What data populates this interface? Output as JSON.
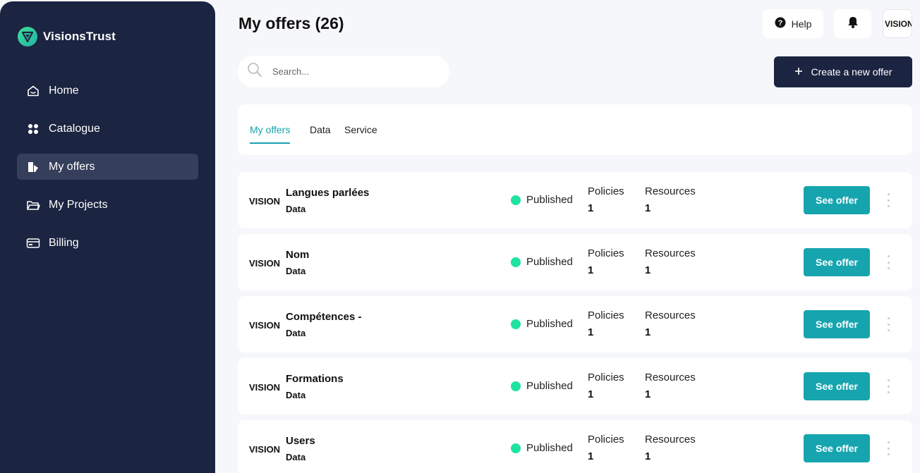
{
  "brand": {
    "name": "VisionsTrust"
  },
  "sidebar": {
    "items": [
      {
        "label": "Home",
        "icon": "home-icon"
      },
      {
        "label": "Catalogue",
        "icon": "grid-icon"
      },
      {
        "label": "My offers",
        "icon": "offers-icon",
        "active": true
      },
      {
        "label": "My Projects",
        "icon": "folder-icon"
      },
      {
        "label": "Billing",
        "icon": "billing-icon"
      }
    ]
  },
  "header": {
    "title": "My offers (26)",
    "help_label": "Help",
    "org_label": "VISIONS"
  },
  "search": {
    "placeholder": "Search..."
  },
  "create_label": "Create a new offer",
  "tabs": [
    {
      "label": "My offers",
      "active": true
    },
    {
      "label": "Data"
    },
    {
      "label": "Service"
    }
  ],
  "offers": [
    {
      "logo": "VISIONS",
      "title": "Langues parlées",
      "type": "Data",
      "status": "Published",
      "policies_label": "Policies",
      "policies": "1",
      "resources_label": "Resources",
      "resources": "1",
      "action": "See offer"
    },
    {
      "logo": "VISIONS",
      "title": "Nom",
      "type": "Data",
      "status": "Published",
      "policies_label": "Policies",
      "policies": "1",
      "resources_label": "Resources",
      "resources": "1",
      "action": "See offer"
    },
    {
      "logo": "VISIONS",
      "title": "Compétences -",
      "type": "Data",
      "status": "Published",
      "policies_label": "Policies",
      "policies": "1",
      "resources_label": "Resources",
      "resources": "1",
      "action": "See offer"
    },
    {
      "logo": "VISIONS",
      "title": "Formations",
      "type": "Data",
      "status": "Published",
      "policies_label": "Policies",
      "policies": "1",
      "resources_label": "Resources",
      "resources": "1",
      "action": "See offer"
    },
    {
      "logo": "VISIONS",
      "title": "Users",
      "type": "Data",
      "status": "Published",
      "policies_label": "Policies",
      "policies": "1",
      "resources_label": "Resources",
      "resources": "1",
      "action": "See offer"
    }
  ],
  "colors": {
    "sidebar_bg": "#1b2440",
    "accent": "#16a5ae",
    "status_published": "#1fe3a0"
  }
}
